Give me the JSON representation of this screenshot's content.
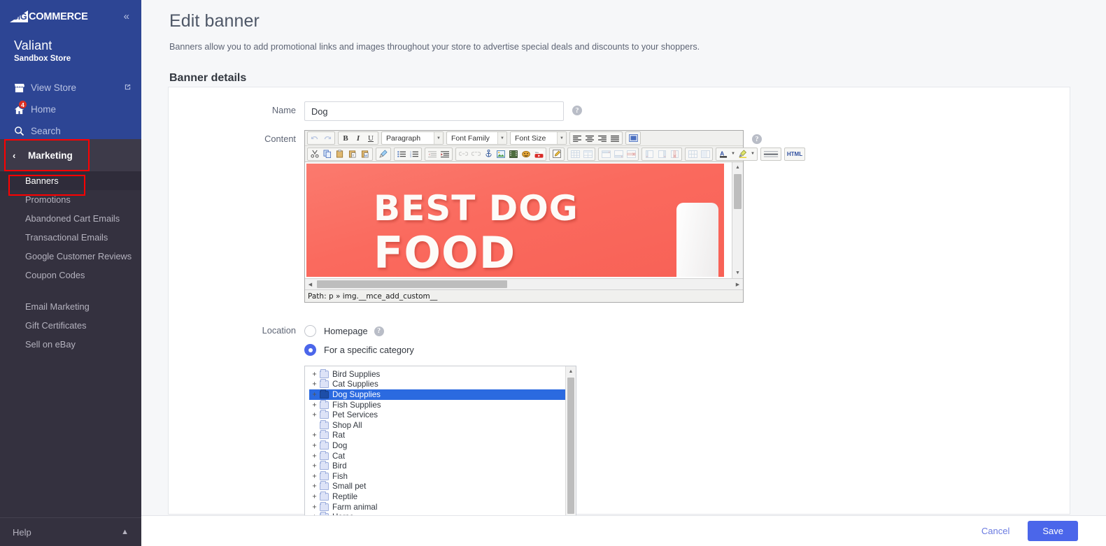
{
  "sidebar": {
    "logo_big": "BIG",
    "logo_commerce": "COMMERCE",
    "collapse_icon": "double-chevron-left-icon",
    "store_name": "Valiant",
    "store_subtitle": "Sandbox Store",
    "top_links": [
      {
        "label": "View Store",
        "icon": "store-icon",
        "external": "↗"
      },
      {
        "label": "Home",
        "icon": "home-icon",
        "badge": "4"
      },
      {
        "label": "Search",
        "icon": "search-icon"
      }
    ],
    "section": {
      "label": "Marketing",
      "chevron": "‹"
    },
    "items": [
      {
        "label": "Banners",
        "active": true
      },
      {
        "label": "Promotions",
        "active": false
      },
      {
        "label": "Abandoned Cart Emails",
        "active": false
      },
      {
        "label": "Transactional Emails",
        "active": false
      },
      {
        "label": "Google Customer Reviews",
        "active": false
      },
      {
        "label": "Coupon Codes",
        "active": false
      },
      {
        "label": "Email Marketing",
        "active": false,
        "gap_before": true
      },
      {
        "label": "Gift Certificates",
        "active": false
      },
      {
        "label": "Sell on eBay",
        "active": false
      }
    ],
    "help": {
      "label": "Help",
      "caret": "⌃"
    }
  },
  "page": {
    "title": "Edit banner",
    "description": "Banners allow you to add promotional links and images throughout your store to advertise special deals and discounts to your shoppers.",
    "section_title": "Banner details"
  },
  "form": {
    "name_label": "Name",
    "name_value": "Dog",
    "name_placeholder": "",
    "name_help_icon": "?",
    "content_label": "Content",
    "content_help_icon": "?",
    "location_label": "Location",
    "location_options": [
      {
        "label": "Homepage",
        "selected": false,
        "help_icon": "?"
      },
      {
        "label": "For a specific category",
        "selected": true
      }
    ]
  },
  "editor": {
    "row1": {
      "undo": "↶",
      "redo": "↷",
      "bold": "B",
      "italic": "I",
      "underline": "U",
      "block_format": "Paragraph",
      "font_family": "Font Family",
      "font_size": "Font Size",
      "align_left": "align-left-icon",
      "align_center": "align-center-icon",
      "align_right": "align-right-icon",
      "align_justify": "align-justify-icon",
      "fullscreen": "fullscreen-icon"
    },
    "row2": {
      "cut": "✂",
      "copy": "copy-icon",
      "paste": "paste-icon",
      "paste_text": "paste-text-icon",
      "paste_word": "paste-word-icon",
      "cleanup": "cleanup-brush-icon",
      "bullet_list": "bullet-list-icon",
      "numbered_list": "numbered-list-icon",
      "outdent": "outdent-icon",
      "indent": "indent-icon",
      "link": "link-icon",
      "unlink": "unlink-icon",
      "anchor": "anchor-icon",
      "image": "image-icon",
      "media": "media-icon",
      "emoji": "emoji-icon",
      "youtube": "youtube-icon",
      "edit_source": "edit-source-icon",
      "table_insert": "insert-table-icon",
      "table_props": "table-properties-icon",
      "row_before": "row-before-icon",
      "row_after": "row-after-icon",
      "row_delete": "delete-row-icon",
      "col_before": "column-before-icon",
      "col_after": "column-after-icon",
      "col_delete": "delete-column-icon",
      "split_cells": "split-cells-icon",
      "merge_cells": "merge-cells-icon",
      "text_color": "A",
      "bg_color": "background-color-icon",
      "horizontal_rule": "horizontal-rule-icon",
      "html_button": "HTML"
    },
    "banner_line1": "BEST DOG",
    "banner_line2": "FOOD",
    "banner_bg_color": "#fa6a5e",
    "path_label": "Path: p » img.__mce_add_custom__"
  },
  "category_tree": [
    {
      "label": "Bird Supplies",
      "expandable": true,
      "selected": false
    },
    {
      "label": "Cat Supplies",
      "expandable": true,
      "selected": false
    },
    {
      "label": "Dog Supplies",
      "expandable": true,
      "selected": true
    },
    {
      "label": "Fish Supplies",
      "expandable": true,
      "selected": false
    },
    {
      "label": "Pet Services",
      "expandable": true,
      "selected": false
    },
    {
      "label": "Shop All",
      "expandable": false,
      "selected": false
    },
    {
      "label": "Rat",
      "expandable": true,
      "selected": false
    },
    {
      "label": "Dog",
      "expandable": true,
      "selected": false
    },
    {
      "label": "Cat",
      "expandable": true,
      "selected": false
    },
    {
      "label": "Bird",
      "expandable": true,
      "selected": false
    },
    {
      "label": "Fish",
      "expandable": true,
      "selected": false
    },
    {
      "label": "Small pet",
      "expandable": true,
      "selected": false
    },
    {
      "label": "Reptile",
      "expandable": true,
      "selected": false
    },
    {
      "label": "Farm animal",
      "expandable": true,
      "selected": false
    },
    {
      "label": "Horse",
      "expandable": true,
      "selected": false
    }
  ],
  "footer": {
    "cancel_label": "Cancel",
    "save_label": "Save"
  },
  "colors": {
    "sidebar_top": "#2d4594",
    "sidebar_body": "#34313f",
    "accent": "#4b66ea",
    "annotation": "#ff0000",
    "selection": "#2b6ae0"
  }
}
